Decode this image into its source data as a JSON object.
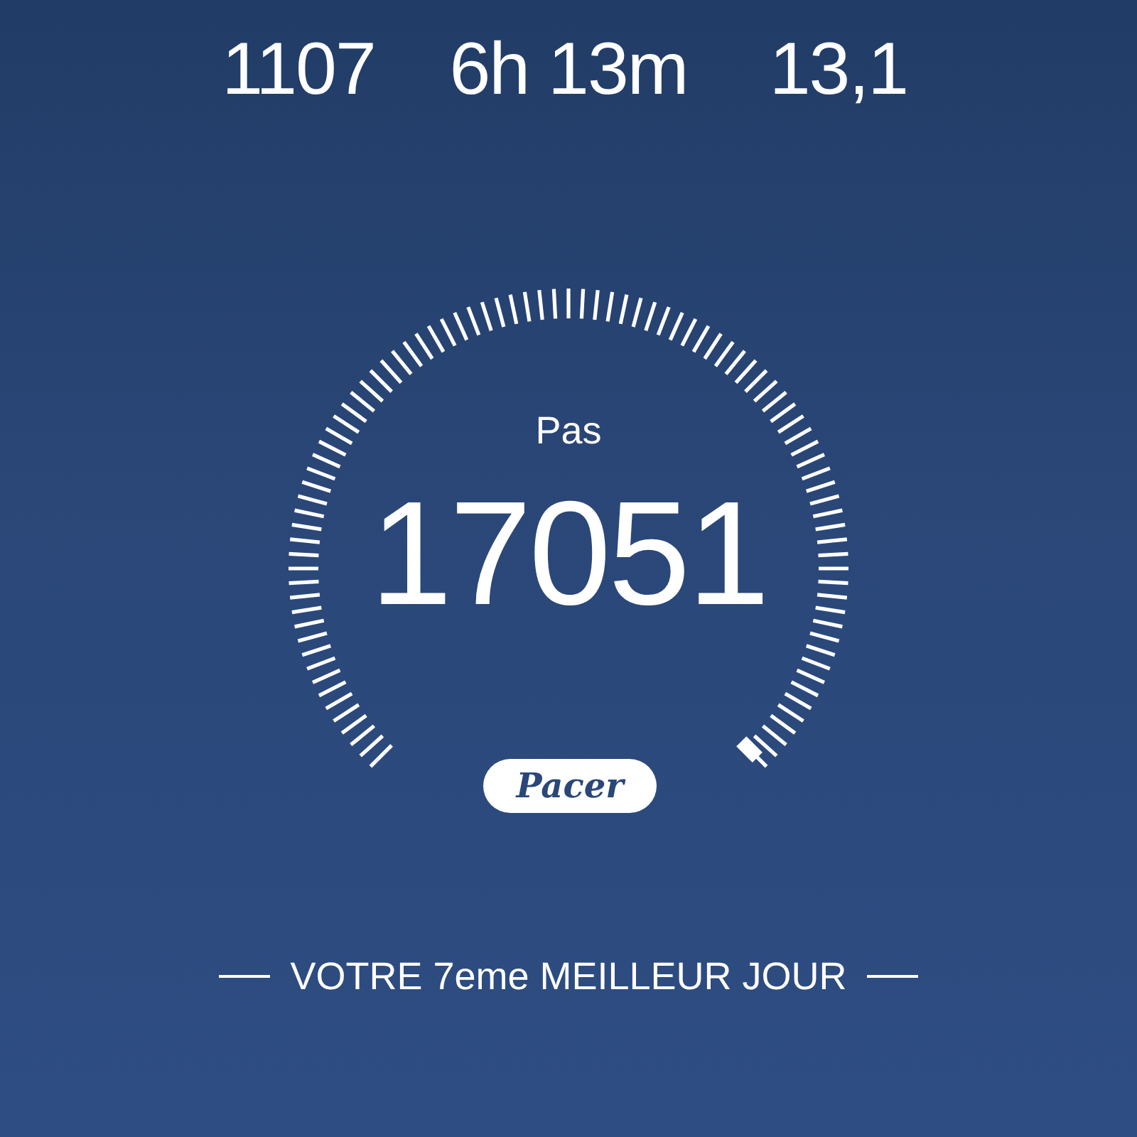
{
  "stats": [
    {
      "value": "1107"
    },
    {
      "value": "6h 13m"
    },
    {
      "value": "13,1"
    }
  ],
  "gauge": {
    "label": "Pas",
    "value": "17051"
  },
  "badge": {
    "text": "Pacer"
  },
  "footer": {
    "text": "VOTRE 7eme MEILLEUR JOUR"
  }
}
